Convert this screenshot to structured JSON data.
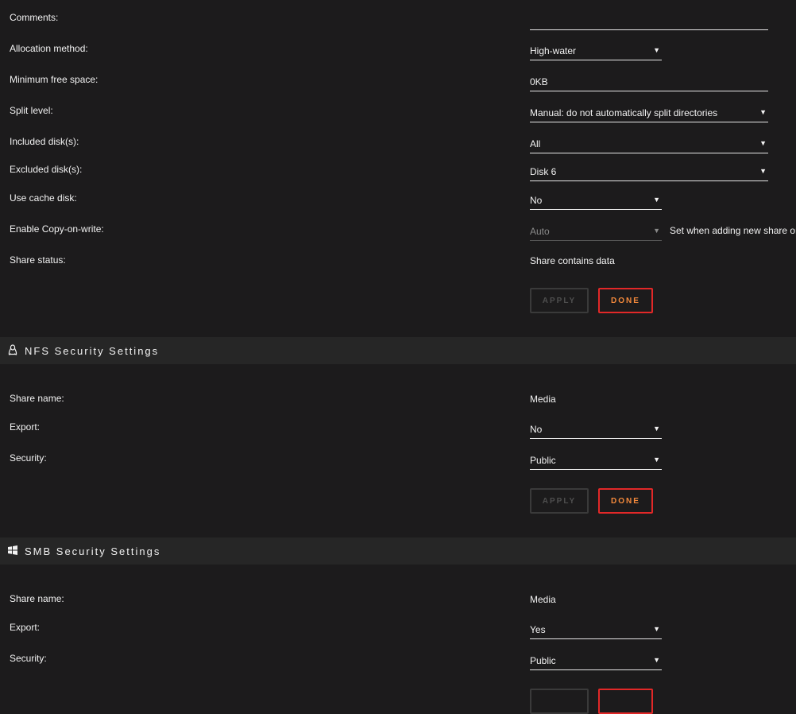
{
  "share": {
    "comments_label": "Comments:",
    "comments_value": "",
    "allocation_label": "Allocation method:",
    "allocation_value": "High-water",
    "min_free_label": "Minimum free space:",
    "min_free_value": "0KB",
    "split_label": "Split level:",
    "split_value": "Manual: do not automatically split directories",
    "included_label": "Included disk(s):",
    "included_value": "All",
    "excluded_label": "Excluded disk(s):",
    "excluded_value": "Disk 6",
    "cache_label": "Use cache disk:",
    "cache_value": "No",
    "cow_label": "Enable Copy-on-write:",
    "cow_value": "Auto",
    "cow_hint": "Set when adding new share only.",
    "status_label": "Share status:",
    "status_value": "Share contains data",
    "apply_label": "APPLY",
    "done_label": "DONE"
  },
  "nfs": {
    "title": "NFS Security Settings",
    "icon": "linux-penguin-icon",
    "name_label": "Share name:",
    "name_value": "Media",
    "export_label": "Export:",
    "export_value": "No",
    "security_label": "Security:",
    "security_value": "Public",
    "apply_label": "APPLY",
    "done_label": "DONE"
  },
  "smb": {
    "title": "SMB Security Settings",
    "icon": "windows-icon",
    "name_label": "Share name:",
    "name_value": "Media",
    "export_label": "Export:",
    "export_value": "Yes",
    "security_label": "Security:",
    "security_value": "Public"
  },
  "colors": {
    "background": "#1c1b1c",
    "section_bar": "#262626",
    "done_border": "#e22828",
    "done_text": "#f58a3c"
  }
}
